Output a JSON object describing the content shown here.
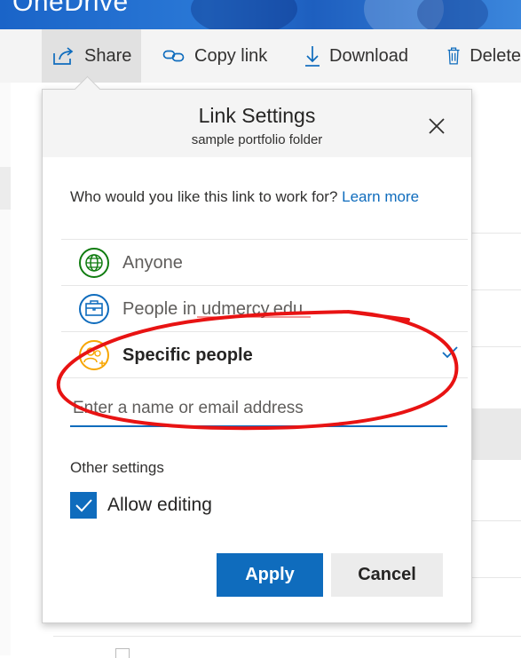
{
  "app": {
    "title": "OneDrive"
  },
  "toolbar": {
    "share_label": "Share",
    "copy_link_label": "Copy link",
    "download_label": "Download",
    "delete_label": "Delete"
  },
  "dialog": {
    "title": "Link Settings",
    "subtitle": "sample portfolio folder",
    "question": "Who would you like this link to work for?",
    "learn_more": "Learn more",
    "options": [
      {
        "label": "Anyone",
        "icon": "globe-icon",
        "color": "#107c10",
        "selected": false
      },
      {
        "label": "People in udmercy.edu",
        "icon": "briefcase-icon",
        "color": "#0f6cbd",
        "selected": false
      },
      {
        "label": "Specific people",
        "icon": "people-icon",
        "color": "#f7a600",
        "selected": true
      }
    ],
    "name_placeholder": "Enter a name or email address",
    "other_settings": "Other settings",
    "allow_editing_label": "Allow editing",
    "allow_editing_checked": true,
    "apply_label": "Apply",
    "cancel_label": "Cancel"
  },
  "colors": {
    "accent": "#0f6cbd",
    "annotation": "#e81313"
  }
}
